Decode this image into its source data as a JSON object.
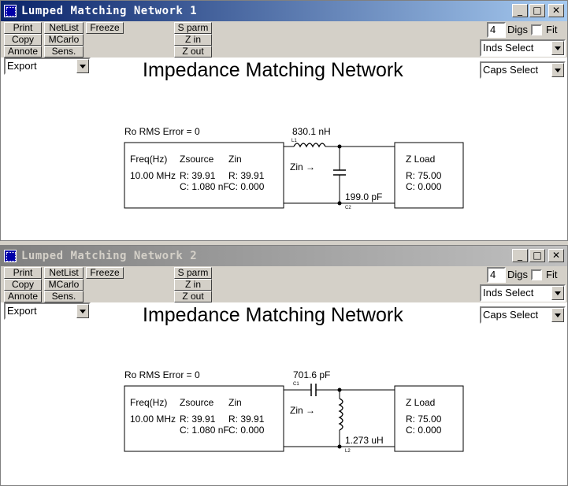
{
  "windows": [
    {
      "title": "Lumped Matching Network 1",
      "buttons": {
        "print": "Print",
        "copy": "Copy",
        "annote": "Annote",
        "netlist": "NetList",
        "mcarlo": "MCarlo",
        "sens": "Sens.",
        "freeze": "Freeze",
        "sparm": "S parm",
        "zin": "Z in",
        "zout": "Z out"
      },
      "export": "Export",
      "digs_value": "4",
      "digs_label": "Digs",
      "fit_label": "Fit",
      "inds_select": "Inds Select",
      "caps_select": "Caps Select",
      "heading": "Impedance Matching Network",
      "circuit": {
        "error": "Ro RMS Error = 0",
        "source_headers": [
          "Freq(Hz)",
          "Zsource",
          "Zin"
        ],
        "freq": "10.00 MHz",
        "r_source": "R: 39.91",
        "r_zin": "R: 39.91",
        "c_source": "C: 1.080 nF",
        "c_zin": "C: 0.000",
        "zin_arrow": "Zin →",
        "load_title": "Z Load",
        "load_r": "R: 75.00",
        "load_c": "C: 0.000",
        "series": {
          "type": "inductor",
          "value": "830.1 nH",
          "ref": "L1"
        },
        "shunt": {
          "type": "capacitor",
          "value": "199.0 pF",
          "ref": "C2"
        }
      }
    },
    {
      "title": "Lumped Matching Network 2",
      "buttons": {
        "print": "Print",
        "copy": "Copy",
        "annote": "Annote",
        "netlist": "NetList",
        "mcarlo": "MCarlo",
        "sens": "Sens.",
        "freeze": "Freeze",
        "sparm": "S parm",
        "zin": "Z in",
        "zout": "Z out"
      },
      "export": "Export",
      "digs_value": "4",
      "digs_label": "Digs",
      "fit_label": "Fit",
      "inds_select": "Inds Select",
      "caps_select": "Caps Select",
      "heading": "Impedance Matching Network",
      "circuit": {
        "error": "Ro RMS Error = 0",
        "source_headers": [
          "Freq(Hz)",
          "Zsource",
          "Zin"
        ],
        "freq": "10.00 MHz",
        "r_source": "R: 39.91",
        "r_zin": "R: 39.91",
        "c_source": "C: 1.080 nF",
        "c_zin": "C: 0.000",
        "zin_arrow": "Zin →",
        "load_title": "Z Load",
        "load_r": "R: 75.00",
        "load_c": "C: 0.000",
        "series": {
          "type": "capacitor",
          "value": "701.6 pF",
          "ref": "C1"
        },
        "shunt": {
          "type": "inductor",
          "value": "1.273 uH",
          "ref": "L2"
        }
      }
    }
  ]
}
